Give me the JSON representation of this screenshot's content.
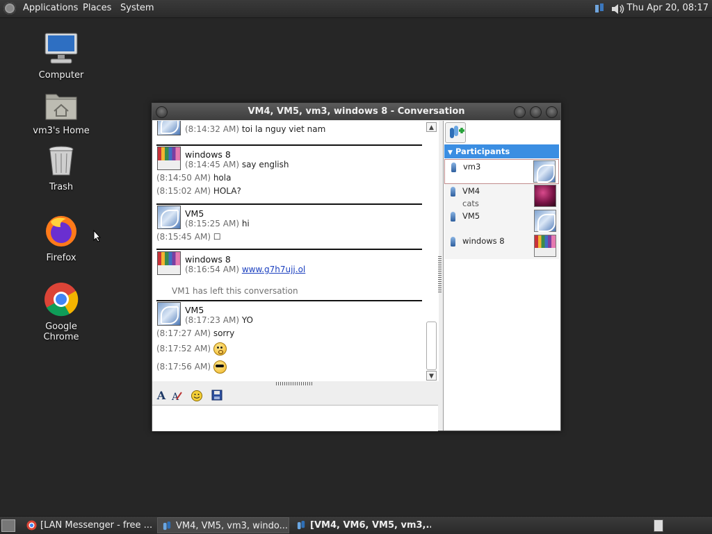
{
  "top_panel": {
    "menus": [
      "Applications",
      "Places",
      "System"
    ],
    "clock": "Thu Apr 20, 08:17"
  },
  "desktop": {
    "icons": [
      {
        "label": "Computer",
        "icon": "computer-icon"
      },
      {
        "label": "vm3's Home",
        "icon": "home-folder-icon"
      },
      {
        "label": "Trash",
        "icon": "trash-icon"
      },
      {
        "label": "Firefox",
        "icon": "firefox-icon"
      },
      {
        "label": "Google Chrome",
        "icon": "chrome-icon"
      }
    ]
  },
  "conversation": {
    "title": "VM4, VM5, vm3, windows 8 - Conversation",
    "messages": {
      "m0_ts": "(8:14:32 AM)",
      "m0_text": "toi la nguy viet nam",
      "m1_name": "windows 8",
      "m1_ts": "(8:14:45 AM)",
      "m1_text": "say english",
      "m2_ts": "(8:14:50 AM)",
      "m2_text": "hola",
      "m3_ts": "(8:15:02 AM)",
      "m3_text": "HOLA?",
      "m4_name": "VM5",
      "m4_ts": "(8:15:25 AM)",
      "m4_text": "hi",
      "m5_ts": "(8:15:45 AM)",
      "m5_text": "☐",
      "m6_name": "windows 8",
      "m6_ts": "(8:16:54 AM)",
      "m6_link": "www.g7h7ujj.ol",
      "sys_text": "VM1 has left this conversation",
      "m7_name": "VM5",
      "m7_ts": "(8:17:23 AM)",
      "m7_text": "YO",
      "m8_ts": "(8:17:27 AM)",
      "m8_text": "sorry",
      "m9_ts": "(8:17:52 AM)",
      "m10_ts": "(8:17:56 AM)"
    },
    "participants_header": "Participants",
    "participants": [
      {
        "name": "vm3",
        "note": ""
      },
      {
        "name": "VM4",
        "note": "cats"
      },
      {
        "name": "VM5",
        "note": ""
      },
      {
        "name": "windows 8",
        "note": ""
      }
    ]
  },
  "taskbar": {
    "tasks": [
      "[LAN Messenger - free ...",
      "VM4, VM5, vm3, windo...",
      "[VM4, VM6, VM5, vm3,..."
    ]
  }
}
